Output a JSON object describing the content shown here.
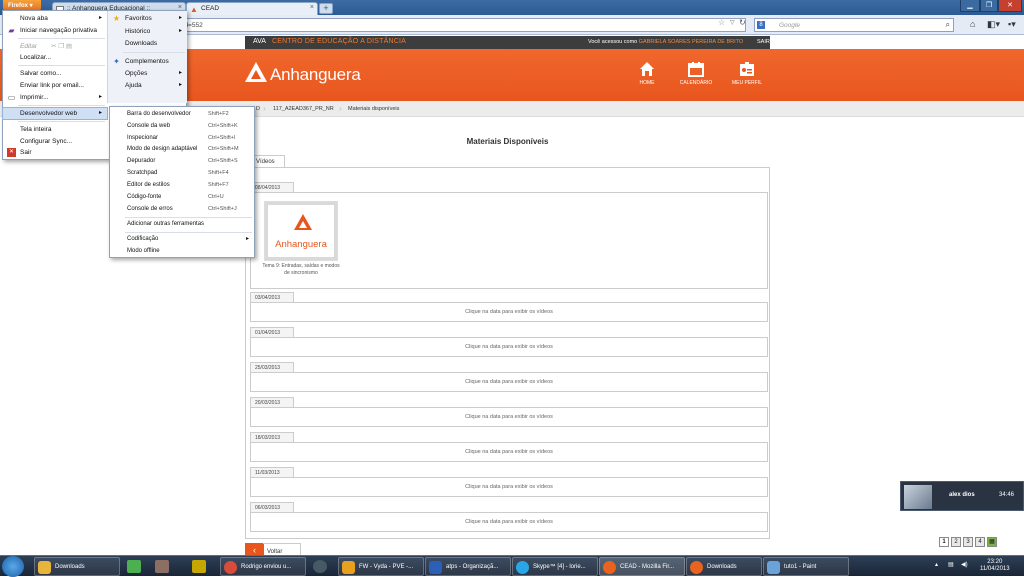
{
  "browser": {
    "menu_button": "Firefox",
    "tabs": [
      {
        "title": ":: Anhanguera Educacional ::"
      },
      {
        "title": "CEAD"
      }
    ],
    "url": "id=552",
    "search_placeholder": "Google",
    "search_engine_letter": "8"
  },
  "firefox_menu": {
    "left": [
      {
        "label": "Nova aba"
      },
      {
        "label": "Iniciar navegação privativa"
      },
      {
        "label": "Editar"
      },
      {
        "label": "Localizar..."
      },
      {
        "label": "Salvar como..."
      },
      {
        "label": "Enviar link por email..."
      },
      {
        "label": "Imprimir..."
      },
      {
        "label": "Desenvolvedor web"
      },
      {
        "label": "Tela inteira"
      },
      {
        "label": "Configurar Sync..."
      },
      {
        "label": "Sair"
      }
    ],
    "right": [
      {
        "label": "Favoritos"
      },
      {
        "label": "Histórico"
      },
      {
        "label": "Downloads"
      },
      {
        "label": "Complementos"
      },
      {
        "label": "Opções"
      },
      {
        "label": "Ajuda"
      }
    ]
  },
  "dev_submenu": [
    {
      "label": "Barra do desenvolvedor",
      "shortcut": "Shift+F2"
    },
    {
      "label": "Console da web",
      "shortcut": "Ctrl+Shift+K"
    },
    {
      "label": "Inspecionar",
      "shortcut": "Ctrl+Shift+I"
    },
    {
      "label": "Modo de design adaptável",
      "shortcut": "Ctrl+Shift+M"
    },
    {
      "label": "Depurador",
      "shortcut": "Ctrl+Shift+S"
    },
    {
      "label": "Scratchpad",
      "shortcut": "Shift+F4"
    },
    {
      "label": "Editor de estilos",
      "shortcut": "Shift+F7"
    },
    {
      "label": "Código-fonte",
      "shortcut": "Ctrl+U"
    },
    {
      "label": "Console de erros",
      "shortcut": "Ctrl+Shift+J"
    },
    {
      "label": "Adicionar outras ferramentas",
      "shortcut": ""
    },
    {
      "label": "Codificação",
      "shortcut": ""
    },
    {
      "label": "Modo offline",
      "shortcut": ""
    }
  ],
  "site": {
    "ava_label": "AVA",
    "ava_title": "CENTRO DE EDUCAÇÃO A DISTÂNCIA",
    "user_prefix": "Você acessou como",
    "user_name": "GABRIELA SOARES PEREIRA DE BRITO",
    "logout": "SAIR",
    "logo_text": "Anhanguera",
    "nav": [
      {
        "label": "HOME"
      },
      {
        "label": "CALENDÁRIO"
      },
      {
        "label": "MEU PERFIL"
      }
    ],
    "breadcrumbs": [
      "D",
      "117_A2EAD367_PR_NR",
      "Materiais disponíveis"
    ]
  },
  "content": {
    "title": "Materiais Disponíveis",
    "tab": "Vídeos",
    "thumb_logo": "Anhanguera",
    "thumb_caption": "Tema 9: Entradas, saídas e modos de sincronismo",
    "click_text": "Clique na data para exibir os vídeos",
    "dates": [
      "08/04/2013",
      "03/04/2013",
      "01/04/2013",
      "25/03/2013",
      "20/03/2013",
      "18/03/2013",
      "11/03/2013",
      "06/03/2013"
    ],
    "back_label": "Voltar"
  },
  "notification": {
    "name": "alex dios",
    "time": "34:46"
  },
  "pager": [
    "1",
    "2",
    "3",
    "4"
  ],
  "taskbar": {
    "items": [
      {
        "label": "Downloads",
        "color": "#e8b43b"
      },
      {
        "label": "Rodrigo enviou u...",
        "color": "#d94b3b"
      },
      {
        "label": "FW - Vyda - PVE -...",
        "color": "#e8a01e"
      },
      {
        "label": "atps - Organizaçã...",
        "color": "#2b5fb8"
      },
      {
        "label": "Skype™ [4] - lorie...",
        "color": "#29a6e8"
      },
      {
        "label": "CEAD - Mozilla Fir...",
        "color": "#e8641e"
      },
      {
        "label": "Downloads",
        "color": "#e8641e"
      },
      {
        "label": "tuto1 - Paint",
        "color": "#6aa3d8"
      }
    ],
    "time": "23:20",
    "date": "11/04/2013"
  }
}
